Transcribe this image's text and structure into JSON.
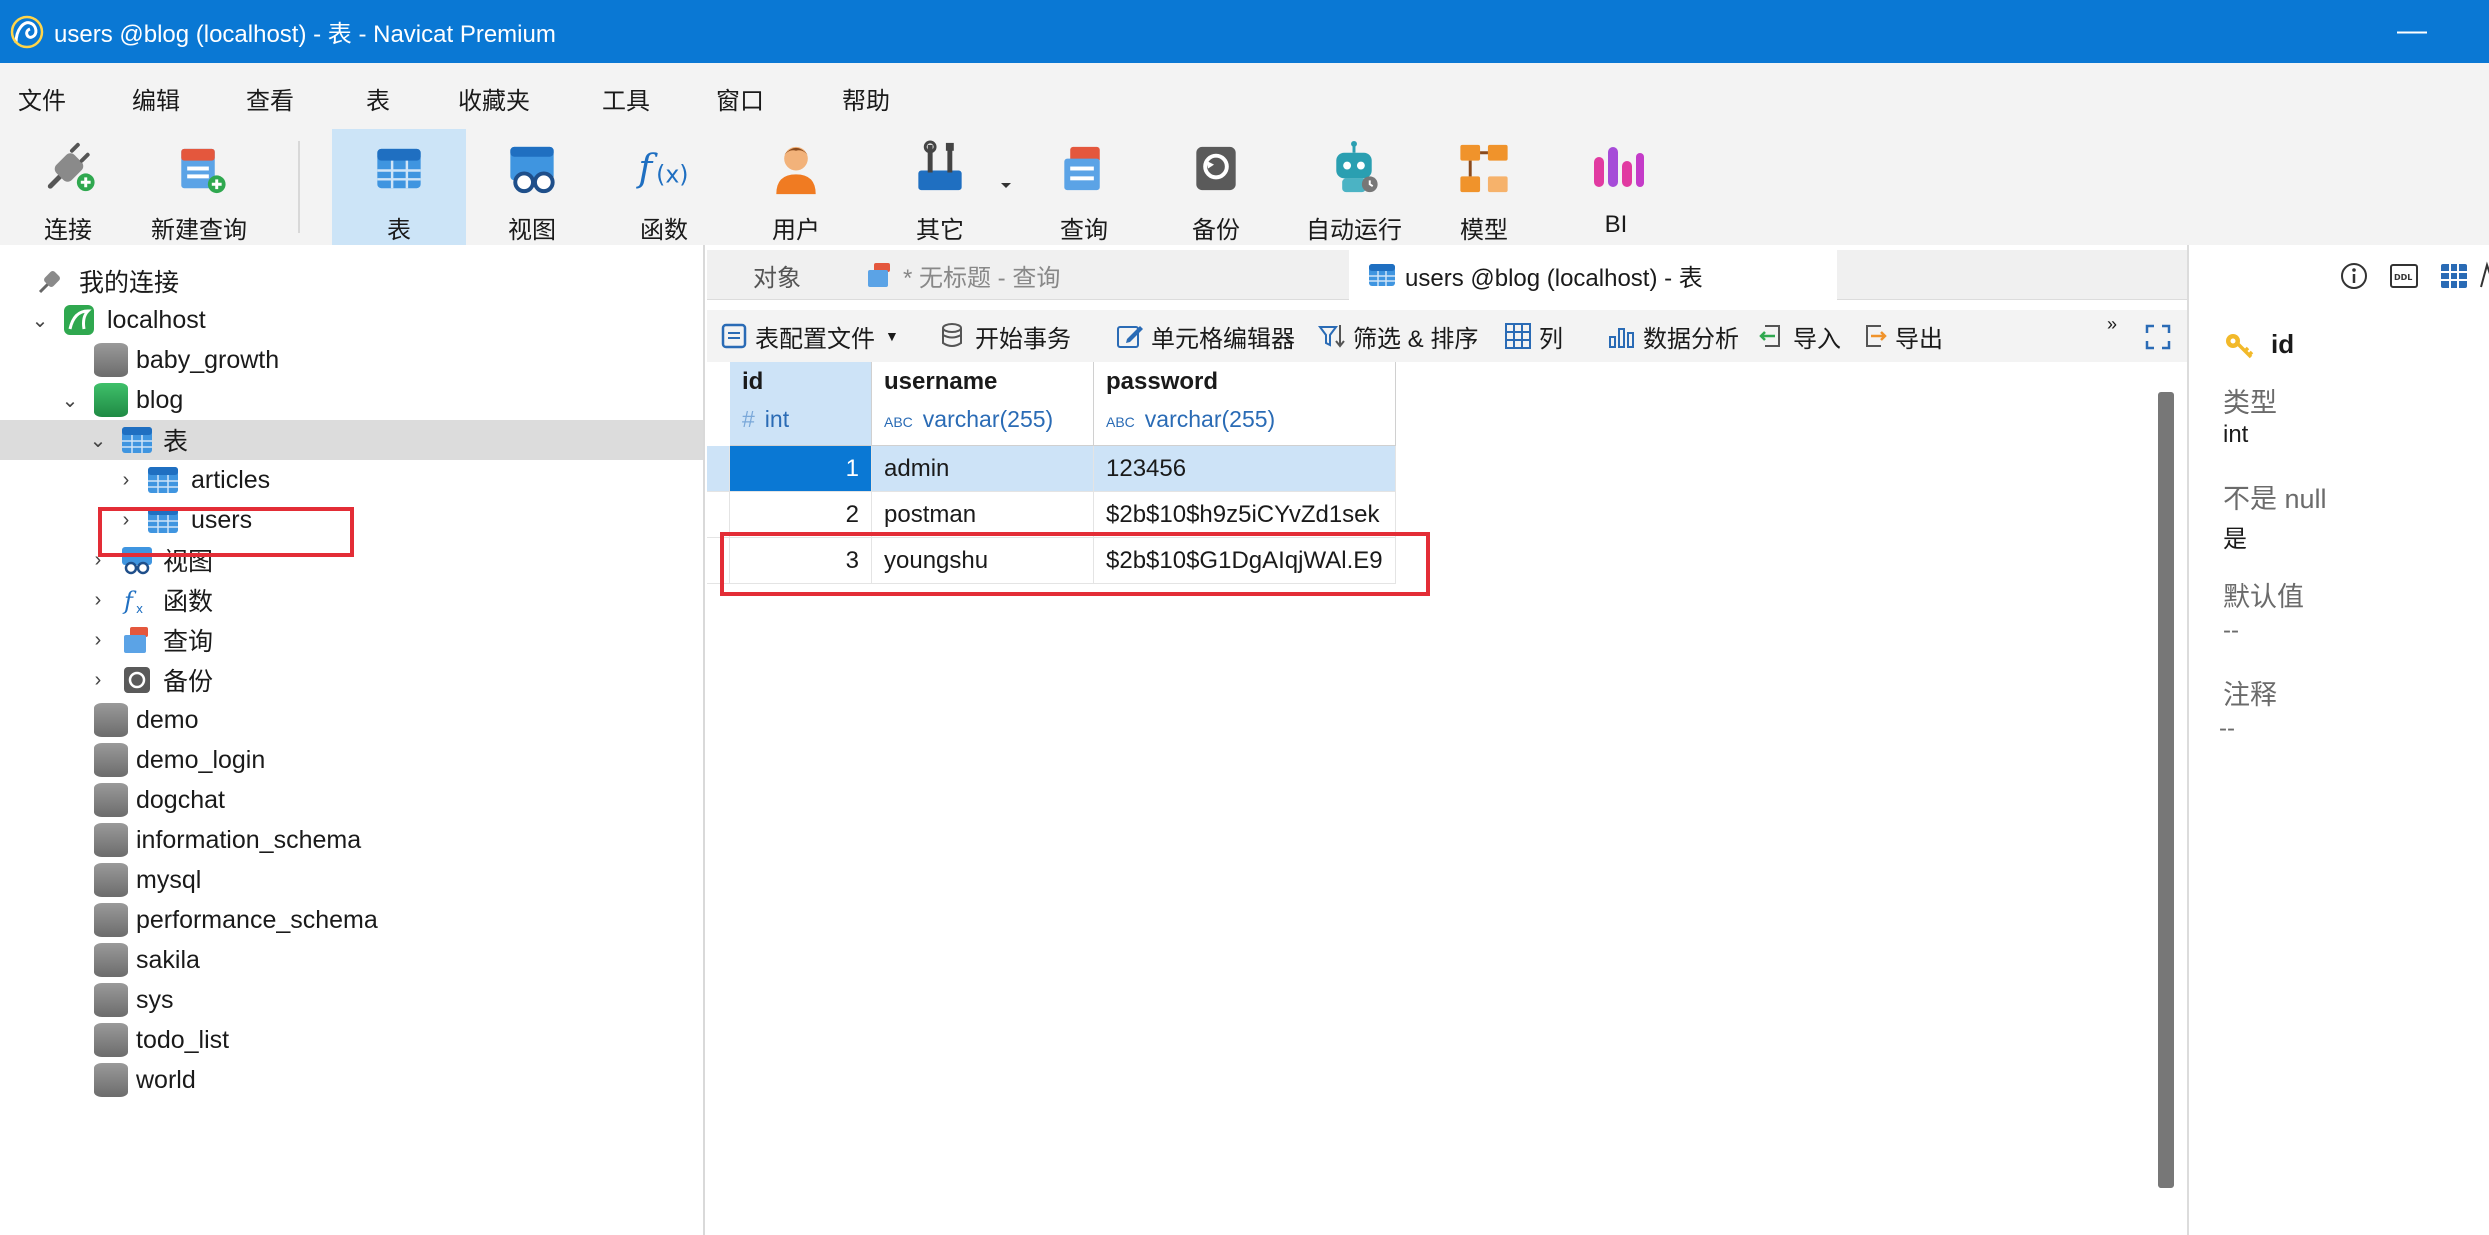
{
  "window": {
    "title": "users @blog (localhost) - 表 - Navicat Premium",
    "minimize_glyph": "—"
  },
  "menu": [
    "文件",
    "编辑",
    "查看",
    "表",
    "收藏夹",
    "工具",
    "窗口",
    "帮助"
  ],
  "toolbar": {
    "connect": "连接",
    "new_query": "新建查询",
    "table": "表",
    "view": "视图",
    "function": "函数",
    "user": "用户",
    "other": "其它",
    "query": "查询",
    "backup": "备份",
    "automation": "自动运行",
    "model": "模型",
    "bi": "BI"
  },
  "tree": {
    "root": "我的连接",
    "connection": "localhost",
    "databases": {
      "baby_growth": "baby_growth",
      "blog": "blog",
      "tables_group": "表",
      "articles": "articles",
      "users": "users",
      "views_group": "视图",
      "functions_group": "函数",
      "queries_group": "查询",
      "backups_group": "备份",
      "demo": "demo",
      "demo_login": "demo_login",
      "dogchat": "dogchat",
      "information_schema": "information_schema",
      "mysql": "mysql",
      "performance_schema": "performance_schema",
      "sakila": "sakila",
      "sys": "sys",
      "todo_list": "todo_list",
      "world": "world"
    }
  },
  "tabs": {
    "objects": "对象",
    "untitled_query": "* 无标题 - 查询",
    "users_table": "users @blog (localhost) - 表"
  },
  "object_toolbar": {
    "table_profile": "表配置文件",
    "begin_transaction": "开始事务",
    "cell_editor": "单元格编辑器",
    "filter_sort": "筛选 & 排序",
    "columns": "列",
    "data_analysis": "数据分析",
    "import": "导入",
    "export": "导出"
  },
  "grid": {
    "columns": [
      {
        "name": "id",
        "type": "int",
        "type_icon": "#"
      },
      {
        "name": "username",
        "type": "varchar(255)",
        "type_icon": "ABC"
      },
      {
        "name": "password",
        "type": "varchar(255)",
        "type_icon": "ABC"
      }
    ],
    "rows": [
      {
        "id": "1",
        "username": "admin",
        "password": "123456"
      },
      {
        "id": "2",
        "username": "postman",
        "password": "$2b$10$h9z5iCYvZd1sek"
      },
      {
        "id": "3",
        "username": "youngshu",
        "password": "$2b$10$G1DgAIqjWAl.E9"
      }
    ]
  },
  "properties": {
    "field_name": "id",
    "type_label": "类型",
    "type_value": "int",
    "not_null_label": "不是 null",
    "not_null_value": "是",
    "default_label": "默认值",
    "default_value": "--",
    "comment_label": "注释",
    "comment_value": "--"
  },
  "colors": {
    "titlebar": "#0a78d4",
    "selection": "#0a78d4",
    "highlight_box": "#e32d36"
  }
}
